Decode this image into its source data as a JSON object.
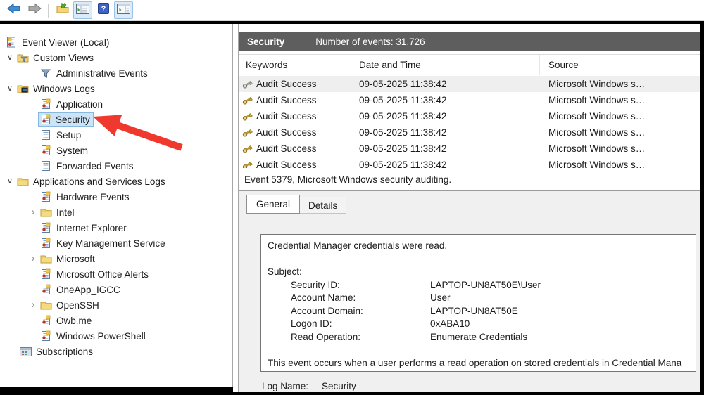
{
  "colors": {
    "titlebar_bg": "#5e5e5e",
    "selection_bg": "#cce4f7",
    "selection_border": "#88b8dd",
    "arrow_red": "#f0392e",
    "toolbar_highlight": "#dcebfa"
  },
  "toolbar": {
    "buttons": [
      {
        "name": "back-button",
        "icon": "back-arrow-icon",
        "highlighted": false
      },
      {
        "name": "forward-button",
        "icon": "forward-arrow-icon",
        "highlighted": false
      },
      {
        "type": "separator"
      },
      {
        "name": "open-saved-log-button",
        "icon": "open-saved-log-icon",
        "highlighted": false
      },
      {
        "name": "show-console-tree-button",
        "icon": "console-tree-icon",
        "highlighted": true
      },
      {
        "name": "help-button",
        "icon": "help-icon",
        "highlighted": false
      },
      {
        "name": "show-action-pane-button",
        "icon": "action-pane-icon",
        "highlighted": true
      }
    ]
  },
  "sidebar": {
    "items": [
      {
        "label": "Event Viewer (Local)",
        "icon": "event-viewer-icon",
        "indent": 8,
        "noChevronSlot": true
      },
      {
        "label": "Custom Views",
        "icon": "folder-filter-icon",
        "indent": 4,
        "chevron": "expanded"
      },
      {
        "label": "Administrative Events",
        "icon": "filter-icon",
        "indent": 37
      },
      {
        "label": "Windows Logs",
        "icon": "folder-logs-icon",
        "indent": 4,
        "chevron": "expanded"
      },
      {
        "label": "Application",
        "icon": "log-alert-icon",
        "indent": 37
      },
      {
        "label": "Security",
        "icon": "log-alert-icon",
        "indent": 37,
        "selected": true
      },
      {
        "label": "Setup",
        "icon": "log-plain-icon",
        "indent": 37
      },
      {
        "label": "System",
        "icon": "log-alert-icon",
        "indent": 37
      },
      {
        "label": "Forwarded Events",
        "icon": "log-plain-icon",
        "indent": 37
      },
      {
        "label": "Applications and Services Logs",
        "icon": "folder-icon",
        "indent": 4,
        "chevron": "expanded"
      },
      {
        "label": "Hardware Events",
        "icon": "log-alert-icon",
        "indent": 37
      },
      {
        "label": "Intel",
        "icon": "folder-icon",
        "indent": 37,
        "chevron": "collapsed"
      },
      {
        "label": "Internet Explorer",
        "icon": "log-alert-icon",
        "indent": 37
      },
      {
        "label": "Key Management Service",
        "icon": "log-alert-icon",
        "indent": 37
      },
      {
        "label": "Microsoft",
        "icon": "folder-icon",
        "indent": 37,
        "chevron": "collapsed"
      },
      {
        "label": "Microsoft Office Alerts",
        "icon": "log-alert-icon",
        "indent": 37
      },
      {
        "label": "OneApp_IGCC",
        "icon": "log-alert-icon",
        "indent": 37
      },
      {
        "label": "OpenSSH",
        "icon": "folder-icon",
        "indent": 37,
        "chevron": "collapsed"
      },
      {
        "label": "Owb.me",
        "icon": "log-alert-icon",
        "indent": 37
      },
      {
        "label": "Windows PowerShell",
        "icon": "log-alert-icon",
        "indent": 37
      },
      {
        "label": "Subscriptions",
        "icon": "subscriptions-icon",
        "indent": 28,
        "noChevronSlot": true
      }
    ]
  },
  "events_pane": {
    "title": "Security",
    "subtitle": "Number of events: 31,726",
    "columns": {
      "keywords": "Keywords",
      "datetime": "Date and Time",
      "source": "Source"
    },
    "rows": [
      {
        "keywords": "Audit Success",
        "datetime": "09-05-2025 11:38:42",
        "source": "Microsoft Windows s…",
        "selected": true,
        "key_icon": "key-silver-icon"
      },
      {
        "keywords": "Audit Success",
        "datetime": "09-05-2025 11:38:42",
        "source": "Microsoft Windows s…",
        "selected": false,
        "key_icon": "key-gold-icon"
      },
      {
        "keywords": "Audit Success",
        "datetime": "09-05-2025 11:38:42",
        "source": "Microsoft Windows s…",
        "selected": false,
        "key_icon": "key-gold-icon"
      },
      {
        "keywords": "Audit Success",
        "datetime": "09-05-2025 11:38:42",
        "source": "Microsoft Windows s…",
        "selected": false,
        "key_icon": "key-gold-icon"
      },
      {
        "keywords": "Audit Success",
        "datetime": "09-05-2025 11:38:42",
        "source": "Microsoft Windows s…",
        "selected": false,
        "key_icon": "key-gold-icon"
      },
      {
        "keywords": "Audit Success",
        "datetime": "09-05-2025 11:38:42",
        "source": "Microsoft Windows s…",
        "selected": false,
        "key_icon": "key-gold-icon"
      }
    ]
  },
  "detail_pane": {
    "header": "Event 5379, Microsoft Windows security auditing.",
    "tabs": {
      "general": "General",
      "details": "Details"
    },
    "body": {
      "line1": "Credential Manager credentials were read.",
      "subject_label": "Subject:",
      "fields": [
        {
          "label": "Security ID:",
          "value": "LAPTOP-UN8AT50E\\User"
        },
        {
          "label": "Account Name:",
          "value": "User"
        },
        {
          "label": "Account Domain:",
          "value": "LAPTOP-UN8AT50E"
        },
        {
          "label": "Logon ID:",
          "value": "0xABA10"
        },
        {
          "label": "Read Operation:",
          "value": "Enumerate Credentials"
        }
      ],
      "note": "This event occurs when a user performs a read operation on stored credentials in Credential Mana"
    },
    "footer": {
      "label": "Log Name:",
      "value": "Security"
    }
  }
}
